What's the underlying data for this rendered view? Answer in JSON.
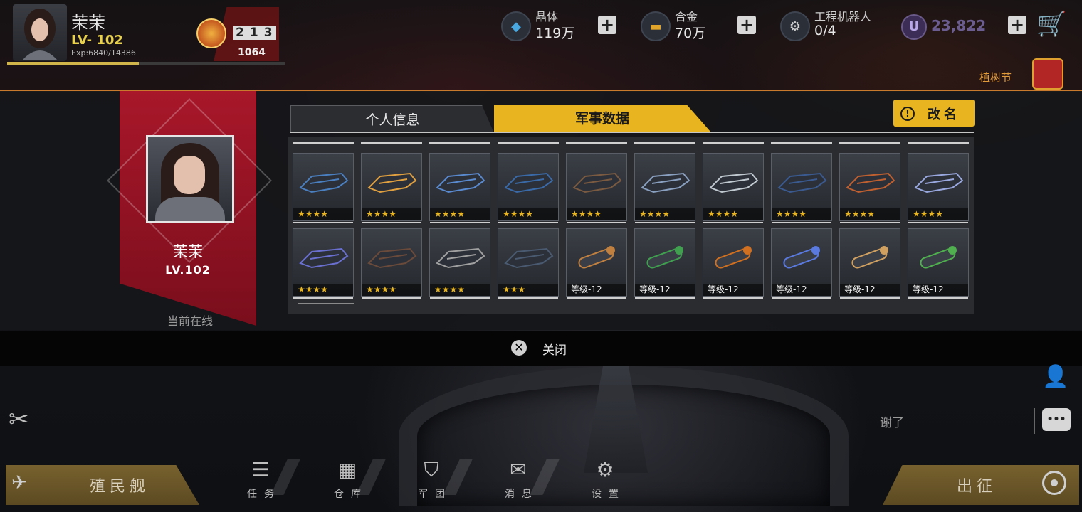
{
  "player": {
    "name": "茉茉",
    "level": "LV- 102",
    "exp": "Exp:6840/14386",
    "exp_progress": 0.4755,
    "rank_podium": [
      "2",
      "1",
      "3"
    ],
    "rank_score": "1064"
  },
  "resources": [
    {
      "icon": "crystal-icon",
      "label": "晶体",
      "value": "119万"
    },
    {
      "icon": "alloy-icon",
      "label": "合金",
      "value": "70万"
    },
    {
      "icon": "robot-icon",
      "label": "工程机器人",
      "value": "0/4"
    }
  ],
  "currency": {
    "icon": "u-coin-icon",
    "symbol": "U",
    "value": "23,822"
  },
  "event": {
    "label": "植树节",
    "icon": "gift-icon"
  },
  "profile_card": {
    "name": "茉茉",
    "level": "LV.102",
    "status": "当前在线"
  },
  "tabs": [
    {
      "label": "个人信息",
      "active": false
    },
    {
      "label": "军事数据",
      "active": true
    }
  ],
  "rename_button": {
    "label": "改名"
  },
  "items": [
    {
      "caption": "★★★★",
      "type": "ship"
    },
    {
      "caption": "★★★★",
      "type": "ship"
    },
    {
      "caption": "★★★★",
      "type": "ship"
    },
    {
      "caption": "★★★★",
      "type": "ship"
    },
    {
      "caption": "★★★★",
      "type": "ship"
    },
    {
      "caption": "★★★★",
      "type": "ship"
    },
    {
      "caption": "★★★★",
      "type": "ship"
    },
    {
      "caption": "★★★★",
      "type": "ship"
    },
    {
      "caption": "★★★★",
      "type": "ship"
    },
    {
      "caption": "★★★★",
      "type": "ship"
    },
    {
      "caption": "★★★★",
      "type": "ship"
    },
    {
      "caption": "★★★★",
      "type": "ship"
    },
    {
      "caption": "★★★★",
      "type": "ship"
    },
    {
      "caption": "★★★",
      "type": "ship"
    },
    {
      "caption": "等级-12",
      "type": "weapon"
    },
    {
      "caption": "等级-12",
      "type": "weapon"
    },
    {
      "caption": "等级-12",
      "type": "weapon"
    },
    {
      "caption": "等级-12",
      "type": "weapon"
    },
    {
      "caption": "等级-12",
      "type": "weapon"
    },
    {
      "caption": "等级-12",
      "type": "weapon"
    }
  ],
  "close": {
    "label": "关闭"
  },
  "chat": {
    "last_message": "谢了"
  },
  "bottom_nav": {
    "colony": "殖民舰",
    "sortie": "出征",
    "items": [
      {
        "label": "任务",
        "icon": "mission-icon"
      },
      {
        "label": "仓库",
        "icon": "warehouse-icon"
      },
      {
        "label": "军团",
        "icon": "legion-icon"
      },
      {
        "label": "消息",
        "icon": "message-icon"
      },
      {
        "label": "设置",
        "icon": "settings-icon"
      }
    ]
  },
  "colors": {
    "accent": "#e8b420",
    "card_red": "#a8172a",
    "topbar_line": "#c97a2c"
  }
}
